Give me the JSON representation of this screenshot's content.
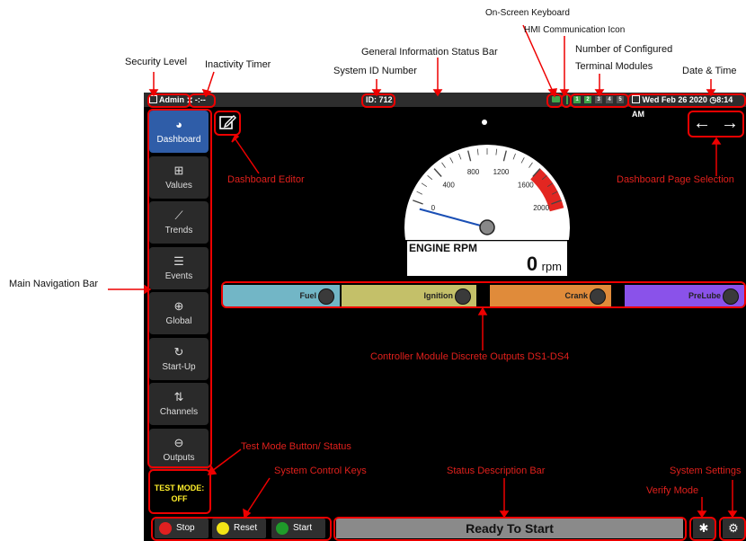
{
  "annotations": {
    "security_level": "Security Level",
    "inactivity_timer": "Inactivity Timer",
    "system_id_number": "System  ID Number",
    "general_info_bar": "General Information Status Bar",
    "on_screen_keyboard": "On-Screen Keyboard",
    "hmi_comm_icon": "HMI Communication Icon",
    "configured_terminal_modules_1": "Number of Configured",
    "configured_terminal_modules_2": "Terminal Modules",
    "date_time": "Date & Time",
    "main_navigation_bar": "Main Navigation Bar",
    "dashboard_editor": "Dashboard Editor",
    "dashboard_page_selection": "Dashboard Page Selection",
    "discrete_outputs": "Controller Module Discrete Outputs DS1-DS4",
    "test_mode_button": "Test Mode Button/ Status",
    "system_control_keys": "System  Control Keys",
    "status_description_bar": "Status Description Bar",
    "system_settings": "System Settings",
    "verify_mode": "Verify Mode"
  },
  "status_bar": {
    "user": "Admin",
    "inactivity": "-:--",
    "system_id": "ID: 712",
    "terminal_modules": [
      "1",
      "2",
      "3",
      "4",
      "5"
    ],
    "datetime": "Wed Feb 26 2020",
    "time": "8:14 AM"
  },
  "nav": {
    "items": [
      {
        "label": "Dashboard",
        "icon": "gauge-icon",
        "glyph": "◕"
      },
      {
        "label": "Values",
        "icon": "table-icon",
        "glyph": "⊞"
      },
      {
        "label": "Trends",
        "icon": "trend-chart-icon",
        "glyph": "⟋"
      },
      {
        "label": "Events",
        "icon": "list-icon",
        "glyph": "☰"
      },
      {
        "label": "Global",
        "icon": "globe-icon",
        "glyph": "⊕"
      },
      {
        "label": "Start-Up",
        "icon": "restart-icon",
        "glyph": "↻"
      },
      {
        "label": "Channels",
        "icon": "sliders-icon",
        "glyph": "⇅"
      },
      {
        "label": "Outputs",
        "icon": "output-icon",
        "glyph": "⊖"
      }
    ]
  },
  "test_mode": {
    "line1": "TEST MODE:",
    "line2": "OFF"
  },
  "gauge": {
    "title": "ENGINE RPM",
    "value": "0",
    "unit": "rpm",
    "min": 0,
    "max": 2000,
    "current": 0,
    "tick_labels": [
      "0",
      "400",
      "800",
      "1200",
      "1600",
      "2000"
    ],
    "redline_start": 1600
  },
  "outputs": [
    {
      "label": "Fuel",
      "color": "#72b6c6"
    },
    {
      "label": "Ignition",
      "color": "#c4c069"
    },
    {
      "label": "Crank",
      "color": "#e08b3a"
    },
    {
      "label": "PreLube",
      "color": "#8a52ea"
    }
  ],
  "control_keys": [
    {
      "label": "Stop",
      "color": "#e02020"
    },
    {
      "label": "Reset",
      "color": "#f2e416"
    },
    {
      "label": "Start",
      "color": "#1f9b2a"
    }
  ],
  "status_description": "Ready To Start",
  "colors": {
    "accent": "#2f5da8",
    "annotation": "#e0201c"
  }
}
